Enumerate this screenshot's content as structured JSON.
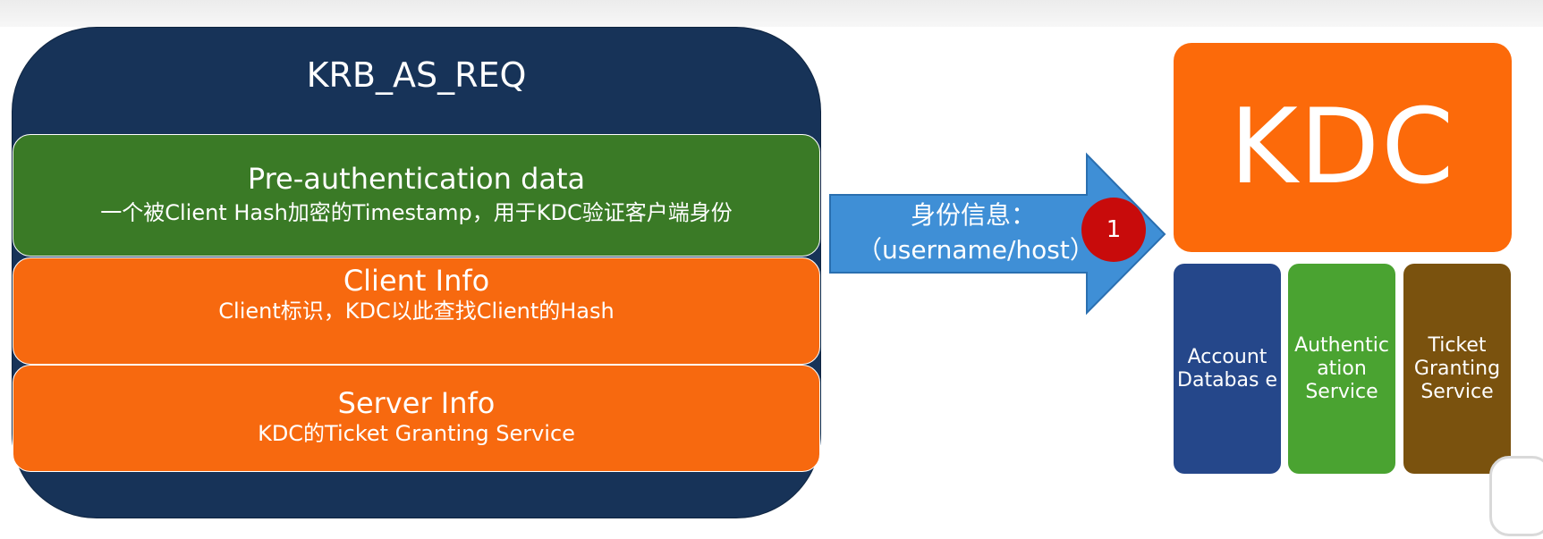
{
  "request": {
    "title": "KRB_AS_REQ",
    "fields": [
      {
        "title": "Pre-authentication data",
        "description": "一个被Client Hash加密的Timestamp，用于KDC验证客户端身份",
        "color": "#3a7a26"
      },
      {
        "title": "Client Info",
        "description": "Client标识，KDC以此查找Client的Hash",
        "color": "#f7690f"
      },
      {
        "title": "Server Info",
        "description": "KDC的Ticket Granting Service",
        "color": "#f7690f"
      }
    ],
    "frame_color": "#173358"
  },
  "arrow": {
    "label_line1": "身份信息：",
    "label_line2": "（username/host）",
    "color": "#3f8fd6",
    "step": "1",
    "step_color": "#c80b0b"
  },
  "kdc": {
    "title": "KDC",
    "color": "#fc6a0a",
    "components": [
      {
        "label": "Account Databas e",
        "color": "#25478a"
      },
      {
        "label": "Authentic ation Service",
        "color": "#4aa331"
      },
      {
        "label": "Ticket Granting Service",
        "color": "#7a520e"
      }
    ]
  }
}
